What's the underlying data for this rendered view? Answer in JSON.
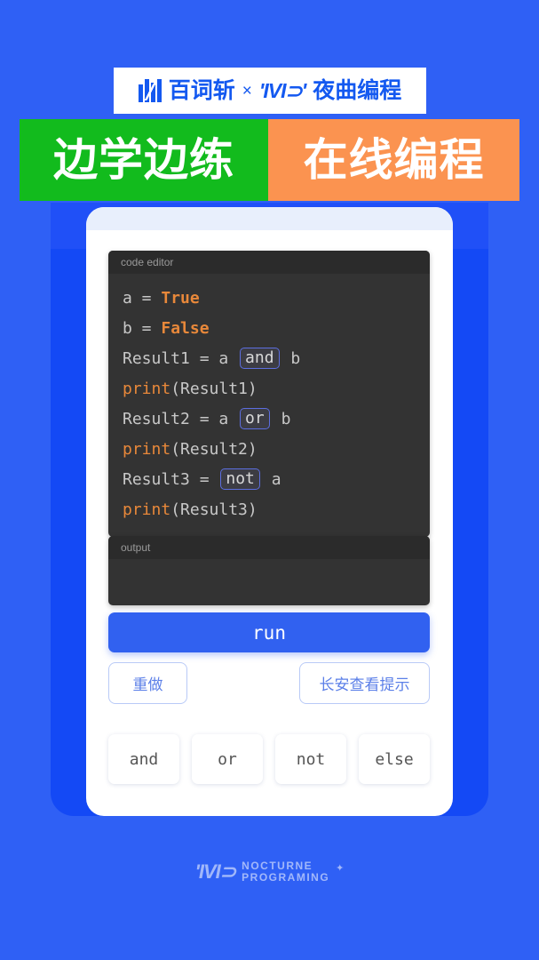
{
  "header": {
    "logo_mark_name": "baicizhan-logo-icon",
    "brand_primary": "百词斩",
    "cross": "×",
    "brand_partner_mark": "'IVI⊃'",
    "brand_partner": "夜曲编程"
  },
  "banner": {
    "left_text": "边学边练",
    "right_text": "在线编程",
    "left_color": "#12bb1d",
    "right_color": "#fb9350"
  },
  "editor": {
    "title": "code editor",
    "lines": [
      {
        "parts": [
          {
            "t": "a = ",
            "k": "plain"
          },
          {
            "t": "True",
            "k": "kw"
          }
        ]
      },
      {
        "parts": [
          {
            "t": "b = ",
            "k": "plain"
          },
          {
            "t": "False",
            "k": "kw"
          }
        ]
      },
      {
        "parts": [
          {
            "t": "Result1 = a ",
            "k": "plain"
          },
          {
            "t": "and",
            "k": "box"
          },
          {
            "t": " b",
            "k": "plain"
          }
        ]
      },
      {
        "parts": [
          {
            "t": "print",
            "k": "fn"
          },
          {
            "t": "(Result1)",
            "k": "plain"
          }
        ]
      },
      {
        "parts": [
          {
            "t": "Result2 = a ",
            "k": "plain"
          },
          {
            "t": "or",
            "k": "box"
          },
          {
            "t": " b",
            "k": "plain"
          }
        ]
      },
      {
        "parts": [
          {
            "t": "print",
            "k": "fn"
          },
          {
            "t": "(Result2)",
            "k": "plain"
          }
        ]
      },
      {
        "parts": [
          {
            "t": "Result3 = ",
            "k": "plain"
          },
          {
            "t": "not",
            "k": "box"
          },
          {
            "t": " a",
            "k": "plain"
          }
        ]
      },
      {
        "parts": [
          {
            "t": "print",
            "k": "fn"
          },
          {
            "t": "(Result3)",
            "k": "plain"
          }
        ]
      }
    ]
  },
  "output": {
    "title": "output",
    "content": ""
  },
  "actions": {
    "run_label": "run",
    "redo_label": "重做",
    "hint_label": "长安查看提示"
  },
  "chips": [
    {
      "label": "and"
    },
    {
      "label": "or"
    },
    {
      "label": "not"
    },
    {
      "label": "else"
    }
  ],
  "footer": {
    "mark": "'IVI⊃",
    "line1": "NOCTURNE",
    "line2": "PROGRAMING",
    "star": "✦"
  },
  "colors": {
    "background": "#2f60f5",
    "frame": "#1449f5",
    "accent": "#3161f0",
    "editor_bg": "#333333",
    "editor_title_bg": "#2b2b2b",
    "keyword": "#e8883a",
    "code_text": "#c8c8c8",
    "token_border": "#5c6ee0"
  }
}
